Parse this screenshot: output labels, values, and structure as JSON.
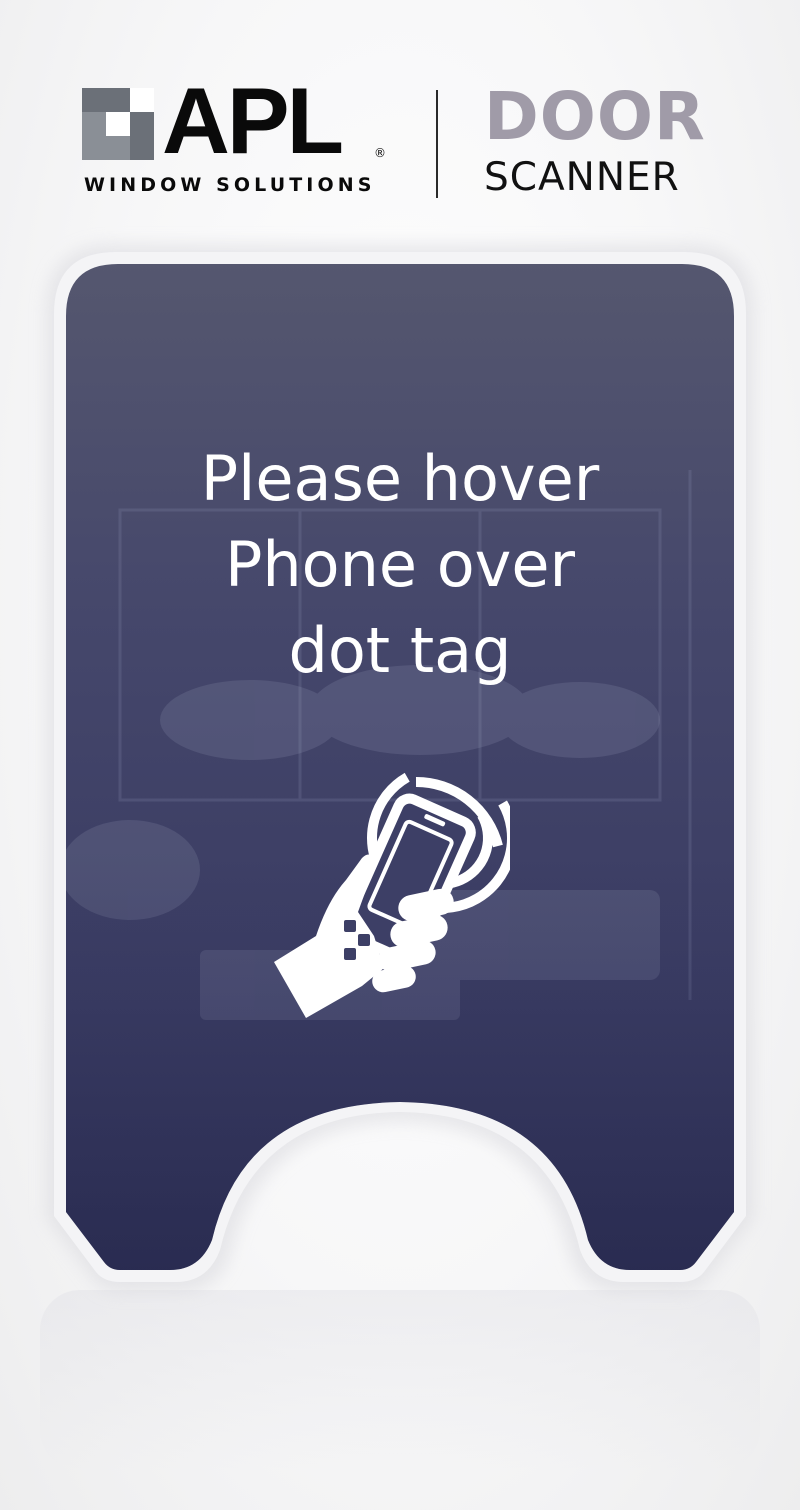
{
  "header": {
    "brand_name": "APL",
    "brand_registered": "®",
    "brand_tagline": "WINDOW SOLUTIONS",
    "product_title_primary": "DOOR",
    "product_title_secondary": "SCANNER"
  },
  "scan_card": {
    "instruction_lines": [
      "Please hover",
      "Phone over",
      "dot tag"
    ],
    "icon": "hand-phone-nfc-icon"
  },
  "colors": {
    "card_overlay": "#3d3f66",
    "door_title": "#a09ba8",
    "logo_mark_grey": "#8a8f96",
    "text_white": "#ffffff"
  }
}
